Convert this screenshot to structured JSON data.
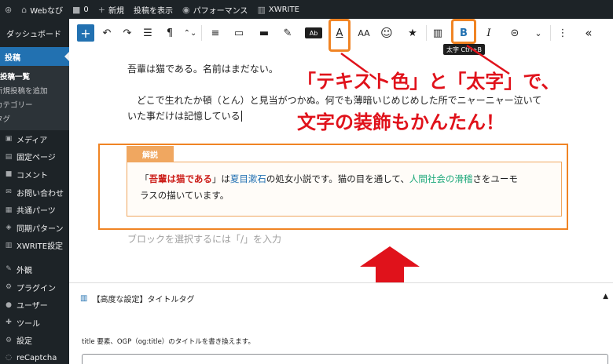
{
  "admin_bar": {
    "site": "Webなび",
    "comments": "0",
    "new": "新規",
    "view": "投稿を表示",
    "performance": "パフォーマンス",
    "xwrite": "XWRITE"
  },
  "sidebar": {
    "dashboard": "ダッシュボード",
    "posts": "投稿",
    "posts_sub": [
      "投稿一覧",
      "新規投稿を追加",
      "カテゴリー",
      "タグ"
    ],
    "items_group1": [
      "メディア",
      "固定ページ",
      "コメント",
      "お問い合わせ",
      "共通パーツ",
      "同期パターン",
      "XWRITE設定"
    ],
    "items_group2": [
      "外観",
      "プラグイン",
      "ユーザー",
      "ツール",
      "設定",
      "reCaptcha"
    ]
  },
  "toolbar": {
    "plus": "+",
    "undo": "↶",
    "redo": "↷",
    "list_view": "☰",
    "paragraph": "¶",
    "move": "⌃⌄",
    "align": "≡",
    "text_color": "A",
    "font_size": "AA",
    "emoji": "☺",
    "bold": "B",
    "italic": "I",
    "link": "⊝",
    "more": "⌄",
    "options": "⋮",
    "collapse": "«",
    "tooltip": "太字 Ctrl+B"
  },
  "content": {
    "p1": "吾輩は猫である。名前はまだない。",
    "p2_line1": "どこで生れたか頓（とん）と見当がつかぬ。何でも薄暗いじめじめした所でニャーニャー泣いて",
    "p2_line2": "いた事だけは記憶している",
    "box_label": "解説",
    "box_text": {
      "q_open": "「",
      "title": "吾輩は猫である",
      "q_close": "」は",
      "author": "夏目漱石",
      "mid": "の処女小説です。猫の目を通して、",
      "theme": "人間社会の滑稽",
      "end1": "さをユーモ",
      "end2": "ラスの描いています。"
    },
    "placeholder": "ブロックを選択するには「/」を入力"
  },
  "callout": {
    "line1": "「テキスト色」と「太字」で、",
    "line2": "文字の装飾もかんたん！"
  },
  "meta": {
    "title": "【高度な設定】タイトルタグ",
    "help": "title 要素、OGP（og:title）のタイトルを書き換えます。",
    "input_value": ""
  },
  "colors": {
    "accent": "#2271b1",
    "highlight": "#f08424",
    "callout": "#e0121b"
  }
}
